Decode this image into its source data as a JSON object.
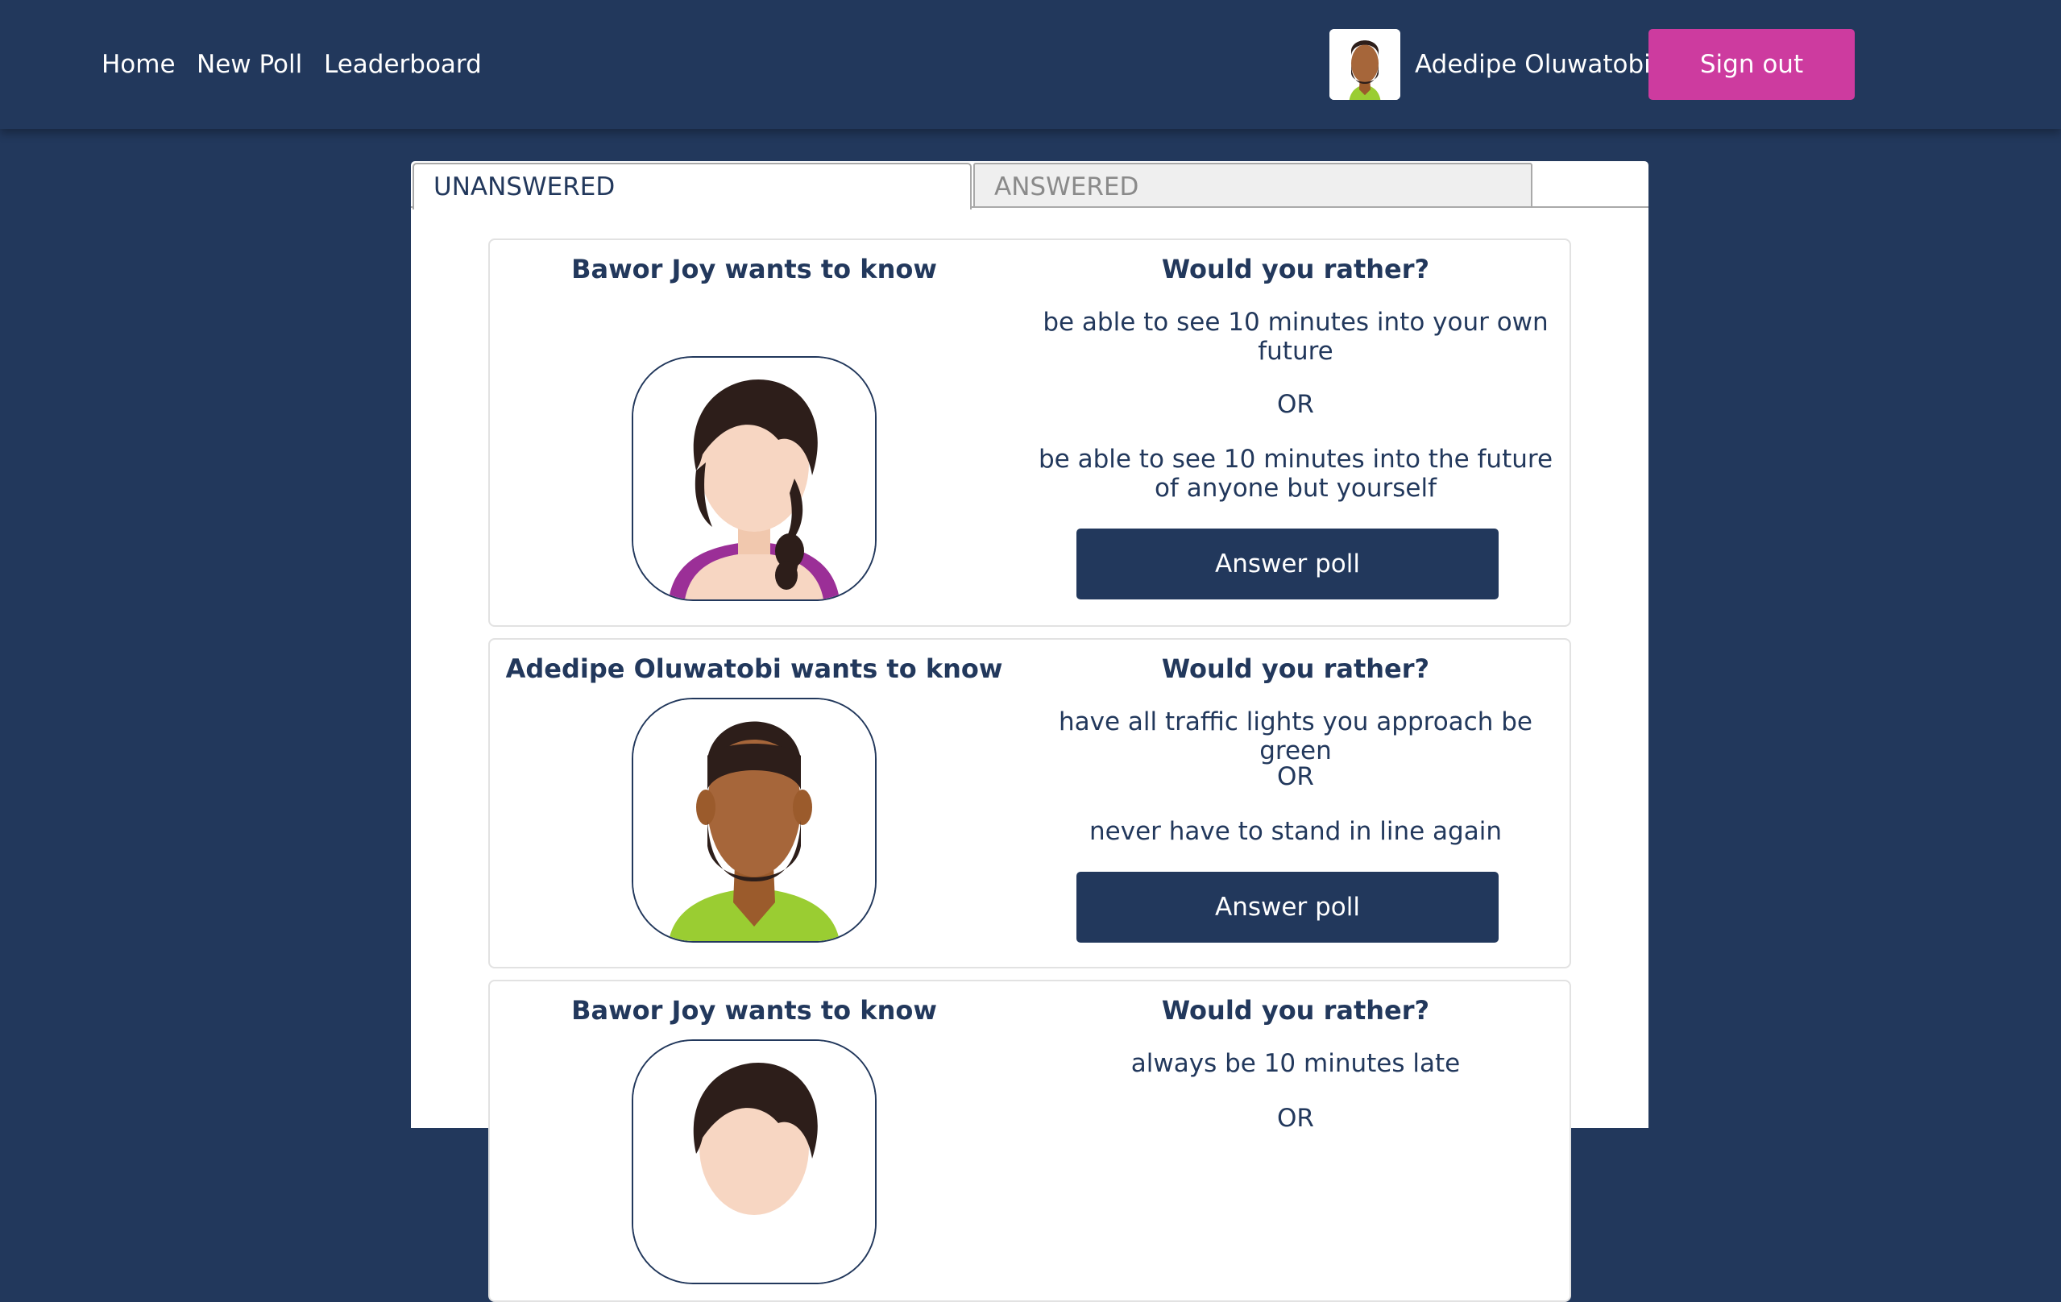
{
  "nav": {
    "links": [
      "Home",
      "New Poll",
      "Leaderboard"
    ],
    "user_name": "Adedipe Oluwatobi",
    "signout_label": "Sign out"
  },
  "tabs": {
    "unanswered": "UNANSWERED",
    "answered": "ANSWERED"
  },
  "polls": [
    {
      "author_line": "Bawor Joy wants to know",
      "avatar": "female-avatar-icon",
      "heading": "Would you rather?",
      "option_one": "be able to see 10 minutes into your own future",
      "or": "OR",
      "option_two": "be able to see 10 minutes into the future of anyone but yourself",
      "button": "Answer poll"
    },
    {
      "author_line": "Adedipe Oluwatobi wants to know",
      "avatar": "male-avatar-icon",
      "heading": "Would you rather?",
      "option_one": "have all traffic lights you approach be green",
      "or": "OR",
      "option_two": "never have to stand in line again",
      "button": "Answer poll"
    },
    {
      "author_line": "Bawor Joy wants to know",
      "avatar": "female-avatar-icon",
      "heading": "Would you rather?",
      "option_one": "always be 10 minutes late",
      "or": "OR"
    }
  ],
  "colors": {
    "navy": "#22385c",
    "accent_pink": "#cd3b9f",
    "card_border": "#e2e2e2"
  }
}
